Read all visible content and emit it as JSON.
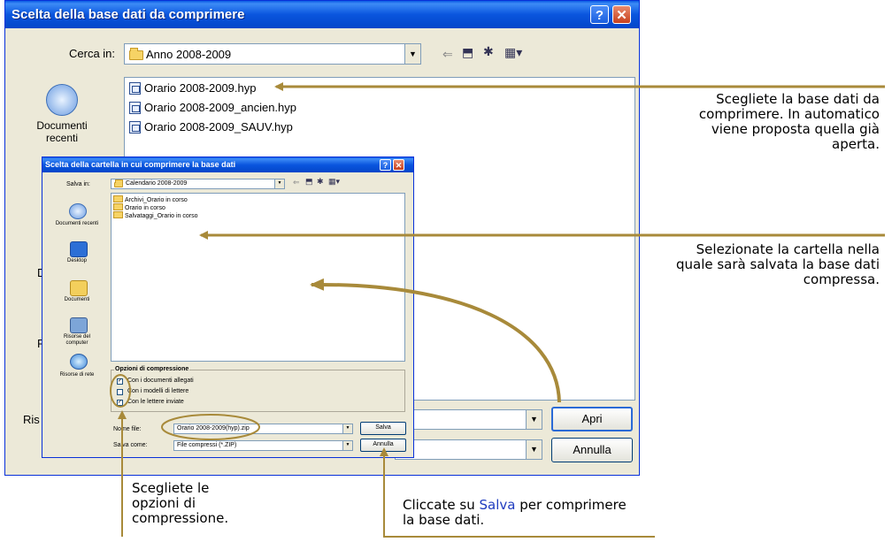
{
  "main_dialog": {
    "title": "Scelta della base dati da comprimere",
    "look_in_label": "Cerca in:",
    "look_in_value": "Anno 2008-2009",
    "files": [
      "Orario 2008-2009.hyp",
      "Orario 2008-2009_ancien.hyp",
      "Orario 2008-2009_SAUV.hyp"
    ],
    "places": [
      {
        "label": "Documenti recenti",
        "icon": "recent-documents-icon"
      }
    ],
    "partial_labels": [
      "D",
      "R",
      "Ris"
    ],
    "open_button": "Apri",
    "cancel_button": "Annulla"
  },
  "save_dialog": {
    "title": "Scelta della cartella in cui comprimere la base dati",
    "save_in_label": "Salva in:",
    "save_in_value": "Calendario 2008-2009",
    "folders": [
      "Archivi_Orario in corso",
      "Orario in corso",
      "Salvataggi_Orario in corso"
    ],
    "places": [
      "Documenti recenti",
      "Desktop",
      "Documenti",
      "Risorse del computer",
      "Risorse di rete"
    ],
    "options_title": "Opzioni di compressione",
    "options": [
      {
        "label": "Con i documenti allegati",
        "checked": true
      },
      {
        "label": "Con i modelli di lettere",
        "checked": false
      },
      {
        "label": "Con le lettere inviate",
        "checked": true
      }
    ],
    "filename_label": "Nome file:",
    "filename_value": "Orario 2008-2009(hyp).zip",
    "savetype_label": "Salva come:",
    "savetype_value": "File compressi (*.ZIP)",
    "save_button": "Salva",
    "cancel_button": "Annulla"
  },
  "annotations": {
    "select_db": "Scegliete la base dati da comprimere. In automatico viene proposta quella già aperta.",
    "select_folder": "Selezionate la cartella nella quale sarà salvata la base dati compressa.",
    "choose_options": "Scegliete le opzioni di compressione.",
    "click_save_pre": "Cliccate su",
    "click_save_word": "Salva",
    "click_save_post": "per comprimere la base dati."
  },
  "colors": {
    "titlebar": "#0a55de",
    "dialog_bg": "#ece9d8",
    "arrow": "#a88a3a",
    "highlight": "#1f3cbf"
  }
}
